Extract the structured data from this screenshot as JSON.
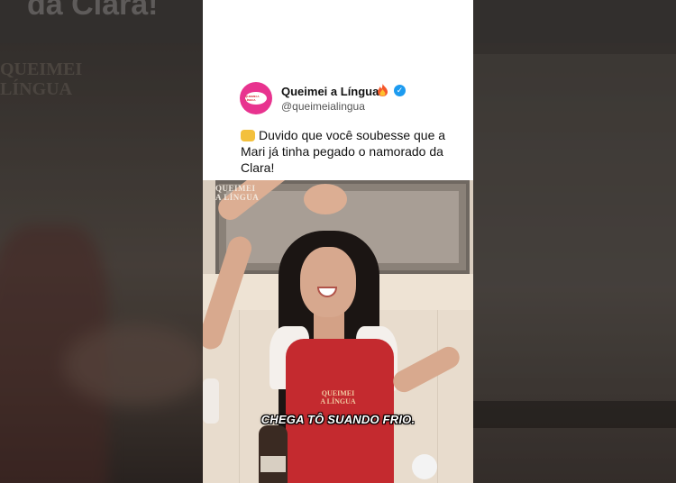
{
  "backdrop": {
    "left_overlay_text": "da Clara!",
    "left_watermark": [
      "QUEIMEI",
      "LÍNGUA"
    ]
  },
  "post": {
    "avatar_text": "QUEIMEI A LÍNGUA",
    "account_name": "Queimei a Língua",
    "flame_icon": "fire-emoji",
    "verified_icon": "verified-badge",
    "handle": "@queimeialingua",
    "emoji_icon": "fist-emoji",
    "text": "Duvido que você soubesse que a Mari já tinha pegado o namorado da Clara!"
  },
  "video": {
    "watermark": [
      "QUEIMEI",
      "A LÍNGUA"
    ],
    "apron_logo": [
      "QUEIMEI",
      "A LÍNGUA"
    ],
    "subtitle": "CHEGA TÔ SUANDO FRIO."
  },
  "colors": {
    "brand_pink": "#e8338f",
    "verified_blue": "#1d9bf0",
    "apron_red": "#c42a2f"
  }
}
